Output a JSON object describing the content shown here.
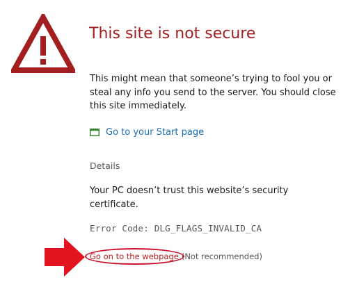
{
  "page": {
    "icon": "warning-triangle-icon",
    "title": "This site is not secure",
    "message": "This might mean that someone’s trying to fool you or steal any info you send to the server. You should close this site immediately.",
    "start_link": {
      "icon": "window-icon",
      "label": "Go to your Start page"
    },
    "details_heading": "Details",
    "cert_message": "Your PC doesn’t trust this website’s security certificate.",
    "error_code": "Error Code:  DLG_FLAGS_INVALID_CA",
    "proceed": {
      "label": "Go on to the webpage",
      "note": "(Not recommended)"
    }
  },
  "annotation": {
    "arrow_icon": "red-arrow-icon",
    "highlight": "red-circle-highlight"
  },
  "colors": {
    "warning_red": "#a31f1f",
    "link_blue": "#1a6fb3",
    "proceed_red": "#b81d1d",
    "annotation_red": "#e3141f",
    "muted_gray": "#555555"
  }
}
